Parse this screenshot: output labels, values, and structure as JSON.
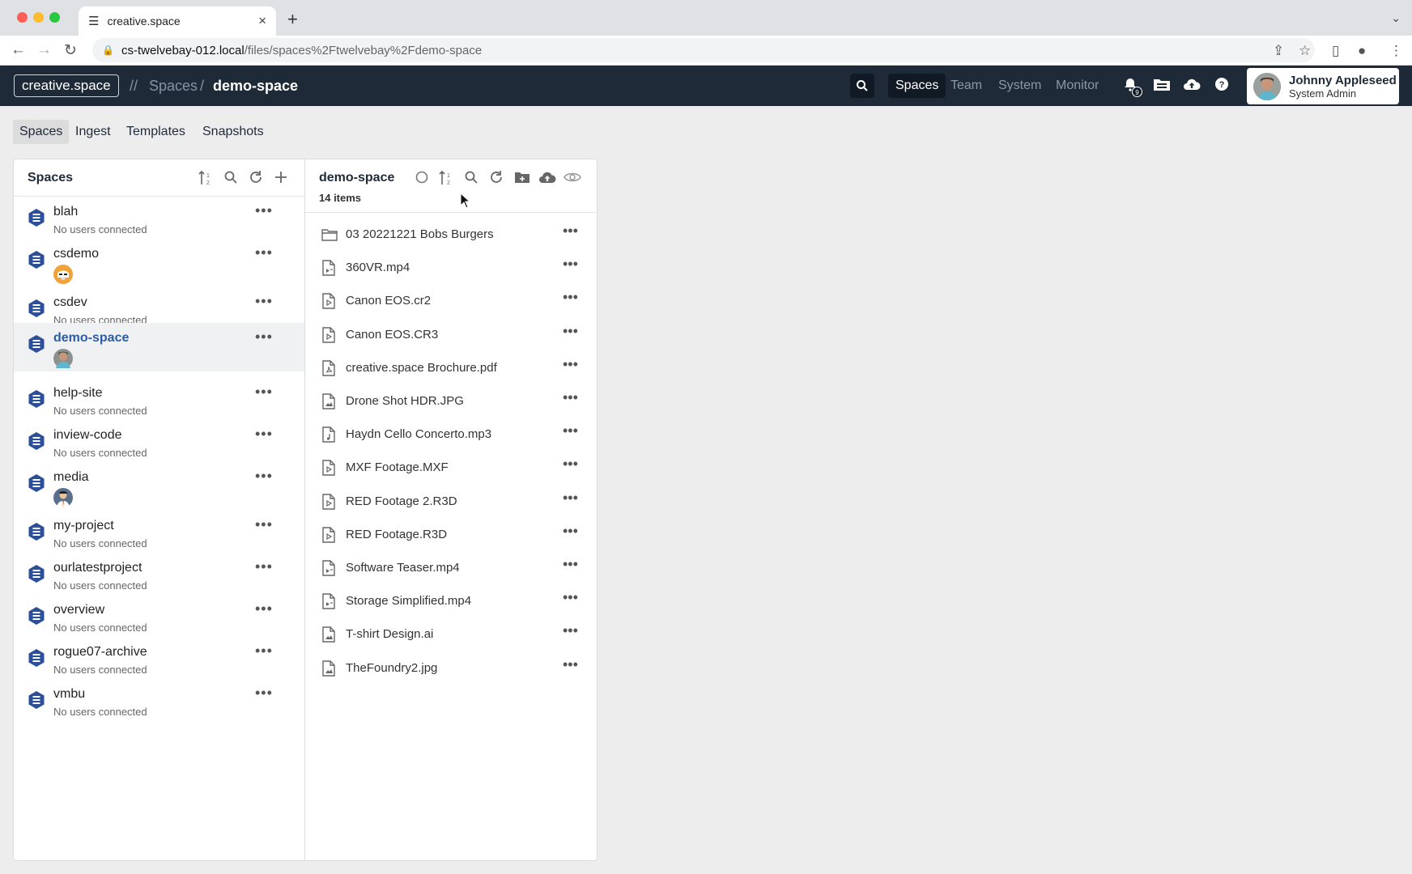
{
  "browser": {
    "tab_title": "creative.space",
    "url_host": "cs-twelvebay-012.local",
    "url_path": "/files/spaces%2Ftwelvebay%2Fdemo-space"
  },
  "header": {
    "logo": "creative.space",
    "breadcrumb_sep": "//",
    "breadcrumb_parent": "Spaces",
    "breadcrumb_slash": "/",
    "breadcrumb_current": "demo-space",
    "nav": [
      "Spaces",
      "Team",
      "System",
      "Monitor"
    ],
    "notification_count": "9",
    "user_name": "Johnny Appleseed",
    "user_role": "System Admin"
  },
  "subnav": [
    "Spaces",
    "Ingest",
    "Templates",
    "Snapshots"
  ],
  "spaces_panel": {
    "title": "Spaces",
    "items": [
      {
        "name": "blah",
        "status": "No users connected"
      },
      {
        "name": "csdemo",
        "status": ""
      },
      {
        "name": "csdev",
        "status": "No users connected"
      },
      {
        "name": "demo-space",
        "status": ""
      },
      {
        "name": "help-site",
        "status": "No users connected"
      },
      {
        "name": "inview-code",
        "status": "No users connected"
      },
      {
        "name": "media",
        "status": ""
      },
      {
        "name": "my-project",
        "status": "No users connected"
      },
      {
        "name": "ourlatestproject",
        "status": "No users connected"
      },
      {
        "name": "overview",
        "status": "No users connected"
      },
      {
        "name": "rogue07-archive",
        "status": "No users connected"
      },
      {
        "name": "vmbu",
        "status": "No users connected"
      }
    ]
  },
  "files_panel": {
    "title": "demo-space",
    "count": "14 items",
    "items": [
      {
        "name": "03 20221221 Bobs Burgers",
        "icon": "folder-icon"
      },
      {
        "name": "360VR.mp4",
        "icon": "video-file-icon"
      },
      {
        "name": "Canon EOS.cr2",
        "icon": "play-file-icon"
      },
      {
        "name": "Canon EOS.CR3",
        "icon": "play-file-icon"
      },
      {
        "name": "creative.space Brochure.pdf",
        "icon": "pdf-file-icon"
      },
      {
        "name": "Drone Shot HDR.JPG",
        "icon": "image-file-icon"
      },
      {
        "name": "Haydn Cello Concerto.mp3",
        "icon": "audio-file-icon"
      },
      {
        "name": "MXF Footage.MXF",
        "icon": "play-file-icon"
      },
      {
        "name": "RED Footage 2.R3D",
        "icon": "play-file-icon"
      },
      {
        "name": "RED Footage.R3D",
        "icon": "play-file-icon"
      },
      {
        "name": "Software Teaser.mp4",
        "icon": "video-file-icon"
      },
      {
        "name": "Storage Simplified.mp4",
        "icon": "video-file-icon"
      },
      {
        "name": "T-shirt Design.ai",
        "icon": "image-file-icon"
      },
      {
        "name": "TheFoundry2.jpg",
        "icon": "image-file-icon"
      }
    ]
  },
  "colors": {
    "header_bg": "#1f2a38",
    "accent": "#2b5da8",
    "hex_icon": "#2c4f9a"
  }
}
